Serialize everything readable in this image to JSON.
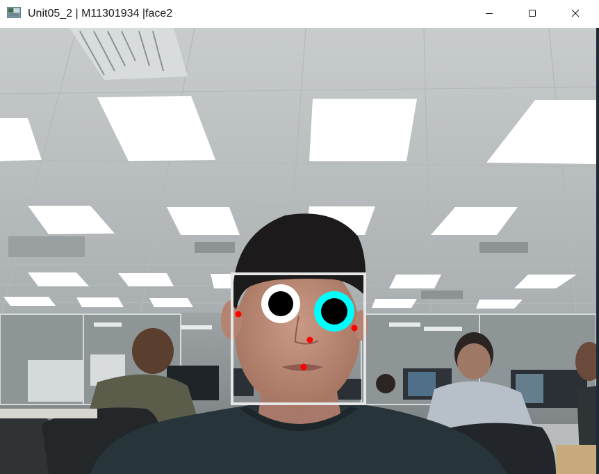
{
  "window": {
    "title": "Unit05_2 | M11301934 |face2",
    "icon": "opencv-window-icon",
    "controls": {
      "minimize": "minimize-icon",
      "maximize": "maximize-icon",
      "close": "close-icon"
    }
  },
  "overlay": {
    "face_box_color": "#e8e8e8",
    "left_eye": {
      "ring_color": "#ffffff",
      "pupil_color": "#000000"
    },
    "right_eye": {
      "ring_color": "#00ffff",
      "pupil_color": "#000000"
    },
    "landmark_color": "#ff0000",
    "landmark_count": 5
  }
}
